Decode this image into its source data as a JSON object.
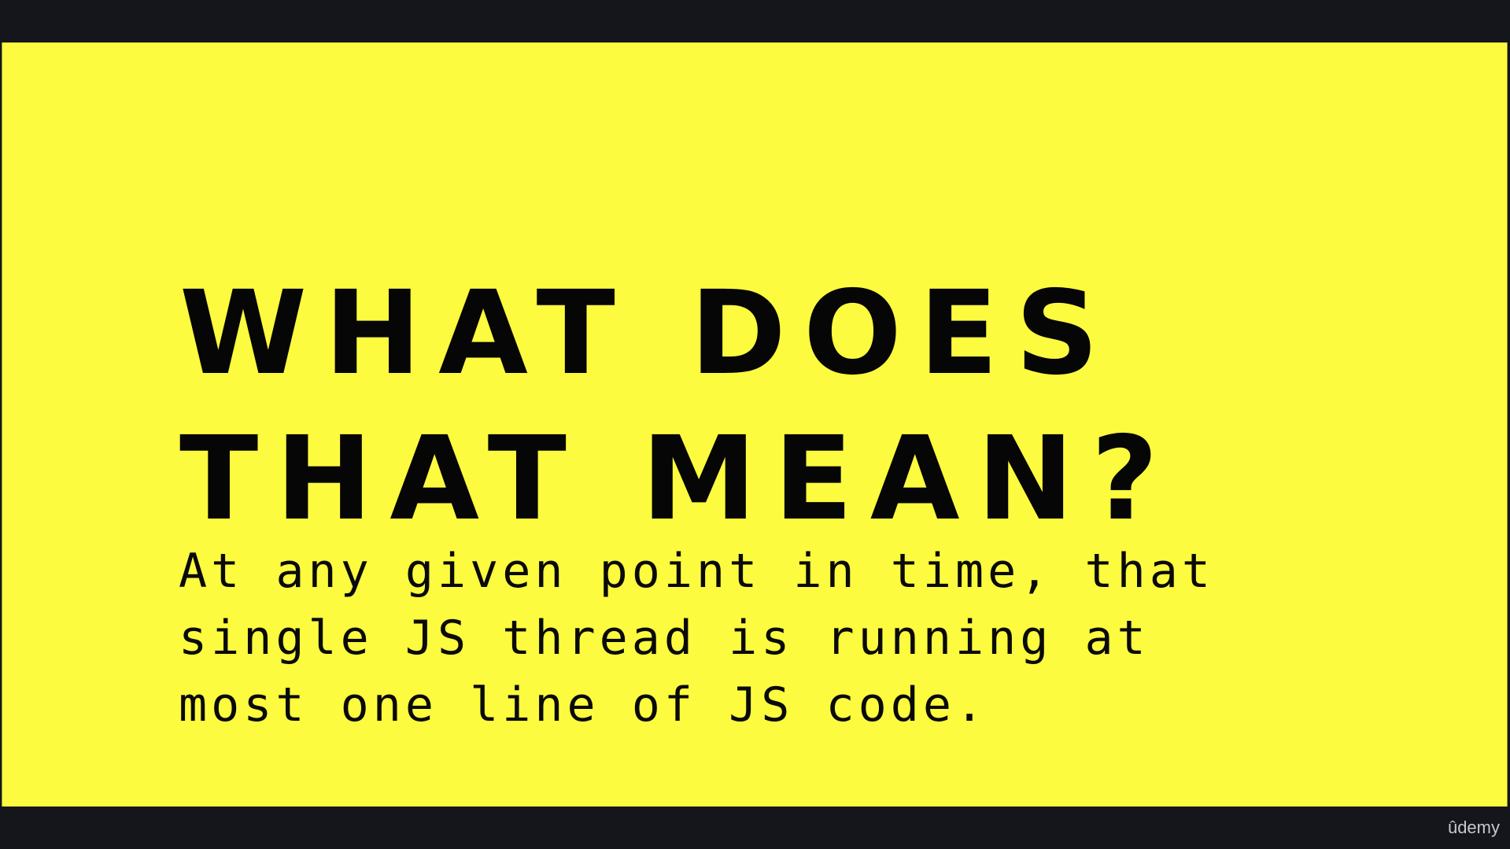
{
  "slide": {
    "background_color": "#fcfb3f",
    "heading_lines": [
      "WHAT DOES",
      "THAT MEAN?"
    ],
    "body_lines": [
      "At any given point in time, that",
      "single JS thread is running at",
      "most one line of JS code."
    ]
  },
  "player": {
    "bar_color": "#14161b",
    "logo_text": "ûdemy"
  }
}
